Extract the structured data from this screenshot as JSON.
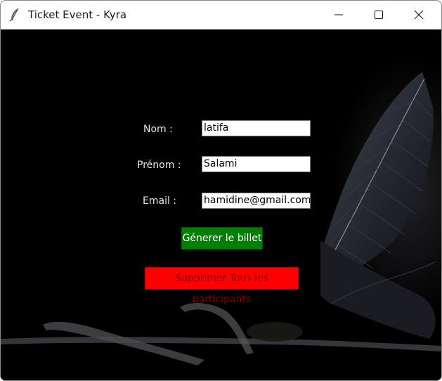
{
  "window": {
    "title": "Ticket Event - Kyra",
    "icon": "feather-icon",
    "controls": [
      "minimize-icon",
      "maximize-icon",
      "close-icon"
    ]
  },
  "form": {
    "nom_label": "Nom :",
    "nom_value": "latifa",
    "prenom_label": "Prénom :",
    "prenom_value": "Salami",
    "email_label": "Email :",
    "email_value": "hamidine@gmail.com"
  },
  "buttons": {
    "generate_label": "Génerer le billet",
    "delete_all_label": "Supprimer Tous les participants"
  },
  "colors": {
    "generate_bg": "#007f00",
    "delete_bg": "#ff0000",
    "background": "#000000"
  }
}
